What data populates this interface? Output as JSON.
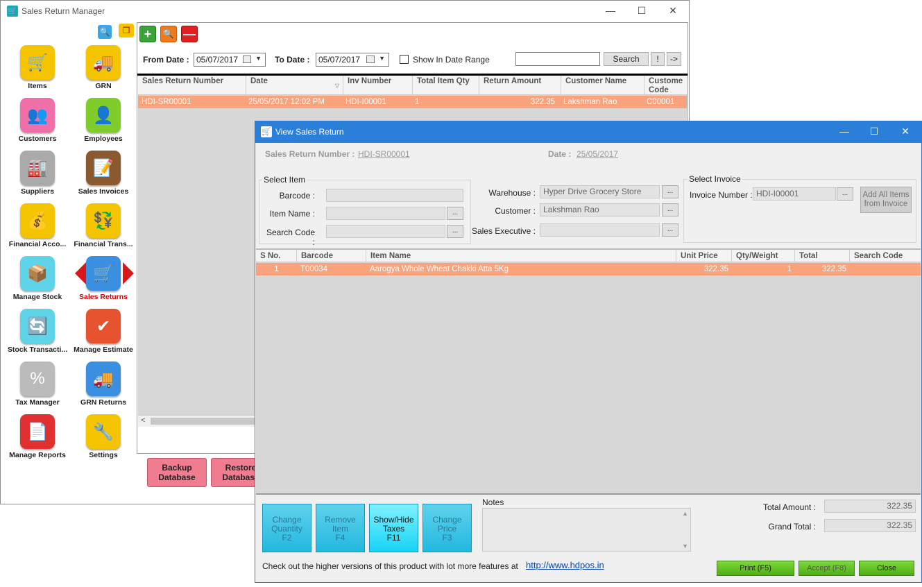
{
  "main_window": {
    "title": "Sales Return Manager",
    "controls": {
      "minimize": "—",
      "maximize": "☐",
      "close": "✕"
    }
  },
  "sidebar": {
    "items": [
      {
        "label": "Items",
        "icon": "shopping-cart-icon",
        "glyph": "🛒",
        "color": "#f5c400",
        "active": false
      },
      {
        "label": "GRN",
        "icon": "truck-icon",
        "glyph": "🚚",
        "color": "#f5c400",
        "active": false
      },
      {
        "label": "Customers",
        "icon": "users-icon",
        "glyph": "👥",
        "color": "#ef6fa8",
        "active": false
      },
      {
        "label": "Employees",
        "icon": "employee-icon",
        "glyph": "👤",
        "color": "#7fcc2a",
        "active": false
      },
      {
        "label": "Suppliers",
        "icon": "factory-icon",
        "glyph": "🏭",
        "color": "#aaaaaa",
        "active": false
      },
      {
        "label": "Sales Invoices",
        "icon": "invoice-icon",
        "glyph": "📝",
        "color": "#8a5a2e",
        "active": false
      },
      {
        "label": "Financial Acco...",
        "icon": "coins-icon",
        "glyph": "💰",
        "color": "#f5c400",
        "active": false
      },
      {
        "label": "Financial Trans...",
        "icon": "coins-transfer-icon",
        "glyph": "💱",
        "color": "#f5c400",
        "active": false
      },
      {
        "label": "Manage Stock",
        "icon": "hand-truck-icon",
        "glyph": "📦",
        "color": "#5fd4e8",
        "active": false
      },
      {
        "label": "Sales Returns",
        "icon": "cart-return-icon",
        "glyph": "🛒",
        "color": "#3b8fe0",
        "active": true
      },
      {
        "label": "Stock Transacti...",
        "icon": "stock-transfer-icon",
        "glyph": "🔄",
        "color": "#5fd4e8",
        "active": false
      },
      {
        "label": "Manage Estimate",
        "icon": "estimate-icon",
        "glyph": "✔",
        "color": "#e8532f",
        "active": false
      },
      {
        "label": "Tax Manager",
        "icon": "percent-icon",
        "glyph": "%",
        "color": "#bbbbbb",
        "active": false
      },
      {
        "label": "GRN Returns",
        "icon": "truck-return-icon",
        "glyph": "🚚",
        "color": "#3b8fe0",
        "active": false
      },
      {
        "label": "Manage Reports",
        "icon": "report-icon",
        "glyph": "📄",
        "color": "#e03030",
        "active": false
      },
      {
        "label": "Settings",
        "icon": "tools-icon",
        "glyph": "🔧",
        "color": "#f5c400",
        "active": false
      }
    ]
  },
  "toolbar": {
    "add": "+",
    "search": "🔍",
    "remove": "—"
  },
  "filter": {
    "from_label": "From Date :",
    "from_value": "05/07/2017",
    "to_label": "To Date :",
    "to_value": "05/07/2017",
    "range_label": "Show In Date Range",
    "search_value": "",
    "search_button": "Search",
    "bang_button": "!",
    "arrow_button": "->"
  },
  "returns_grid": {
    "columns": [
      "Sales Return Number",
      "Date",
      "Inv Number",
      "Total Item Qty",
      "Return Amount",
      "Customer Name",
      "Custome Code"
    ],
    "rows": [
      [
        "HDI-SR00001",
        "25/05/2017 12:02 PM",
        "HDI-I00001",
        "1",
        "322.35",
        "Lakshman Rao",
        "C00001"
      ]
    ],
    "scroll_left": "<"
  },
  "db_buttons": {
    "backup": "Backup Database",
    "restore": "Restore Database"
  },
  "dialog": {
    "title": "View Sales Return",
    "controls": {
      "minimize": "—",
      "maximize": "☐",
      "close": "✕"
    },
    "return_number_label": "Sales Return Number :",
    "return_number_value": "HDI-SR00001",
    "date_label": "Date :",
    "date_value": "25/05/2017",
    "select_item": {
      "title": "Select Item",
      "barcode_label": "Barcode :",
      "barcode_value": "",
      "item_name_label": "Item Name :",
      "item_name_value": "",
      "search_code_label": "Search Code :",
      "search_code_value": ""
    },
    "warehouse_label": "Warehouse :",
    "warehouse_value": "Hyper Drive Grocery Store",
    "customer_label": "Customer :",
    "customer_value": "Lakshman Rao",
    "sales_exec_label": "Sales Executive :",
    "sales_exec_value": "",
    "select_invoice": {
      "title": "Select Invoice",
      "invoice_label": "Invoice Number :",
      "invoice_value": "HDI-I00001",
      "add_all": "Add All Items from Invoice"
    },
    "dots": "...",
    "items_grid": {
      "columns": [
        "S No.",
        "Barcode",
        "Item Name",
        "Unit Price",
        "Qty/Weight",
        "Total",
        "Search Code"
      ],
      "rows": [
        [
          "1",
          "T00034",
          "Aarogya Whole Wheat Chakki Atta 5Kg",
          "322.35",
          "1",
          "322.35",
          ""
        ]
      ]
    },
    "actions": {
      "change_qty": "Change Quantity",
      "change_qty_key": "F2",
      "remove_item": "Remove Item",
      "remove_item_key": "F4",
      "show_taxes": "Show/Hide Taxes",
      "show_taxes_key": "F11",
      "change_price": "Change Price",
      "change_price_key": "F3"
    },
    "notes_label": "Notes",
    "notes_value": "",
    "total_amount_label": "Total Amount :",
    "total_amount_value": "322.35",
    "grand_total_label": "Grand Total :",
    "grand_total_value": "322.35",
    "promo_text": "Check out the higher versions of this product with lot more features at",
    "promo_link": "http://www.hdpos.in",
    "print_button": "Print (F5)",
    "accept_button": "Accept (F8)",
    "close_button": "Close"
  },
  "colors": {
    "selected_row": "#f9a27c",
    "dialog_title": "#2b7fd8",
    "grid_bg": "#d7d7d7"
  }
}
